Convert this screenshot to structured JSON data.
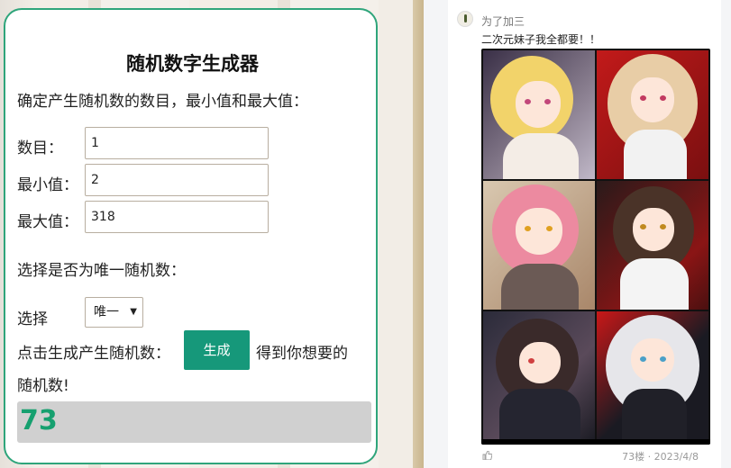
{
  "generator": {
    "title": "随机数字生成器",
    "description": "确定产生随机数的数目，最小值和最大值：",
    "fields": [
      {
        "label": "数目：",
        "value": "1"
      },
      {
        "label": "最小值：",
        "value": "2"
      },
      {
        "label": "最大值：",
        "value": "318"
      }
    ],
    "unique_prompt": "选择是否为唯一随机数：",
    "select_label": "选择",
    "select_value": "唯一",
    "click_text": "点击生成产生随机数：",
    "button_label": "生成",
    "after_text_1": "得到你想要的",
    "after_text_2": "随机数!",
    "result": "73",
    "accent_color": "#16987a",
    "result_color": "#16a06f"
  },
  "post": {
    "author": "为了加三",
    "text": "二次元妹子我全都要！！",
    "like_icon": "thumb-up-icon",
    "meta": "73楼 · 2023/4/8"
  }
}
